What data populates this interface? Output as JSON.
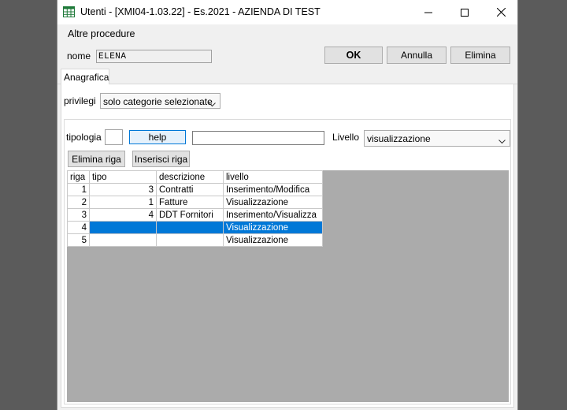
{
  "window": {
    "title": "Utenti - [XMI04-1.03.22] - Es.2021 - AZIENDA DI TEST",
    "menu_label": "Altre procedure",
    "accent_color": "#0078d7"
  },
  "header": {
    "name_label": "nome",
    "name_value": "ELENA",
    "ok_label": "OK",
    "annulla_label": "Annulla",
    "elimina_label": "Elimina"
  },
  "tabs": [
    {
      "label": "Anagrafica",
      "active": true
    }
  ],
  "privileges": {
    "label": "privilegi",
    "selected": "solo categorie selezionate"
  },
  "filter": {
    "tipologia_label": "tipologia",
    "tipologia_value": "",
    "help_label": "help",
    "text_value": "",
    "livello_label": "Livello",
    "livello_selected": "visualizzazione"
  },
  "actions": {
    "delete_row_label": "Elimina riga",
    "insert_row_label": "Inserisci riga"
  },
  "grid": {
    "columns": [
      "riga",
      "tipo",
      "descrizione",
      "livello"
    ],
    "rows": [
      {
        "riga": "1",
        "tipo": "3",
        "descrizione": "Contratti",
        "livello": "Inserimento/Modifica"
      },
      {
        "riga": "2",
        "tipo": "1",
        "descrizione": "Fatture",
        "livello": "Visualizzazione"
      },
      {
        "riga": "3",
        "tipo": "4",
        "descrizione": "DDT Fornitori",
        "livello": "Inserimento/Visualizza"
      },
      {
        "riga": "4",
        "tipo": "",
        "descrizione": "",
        "livello": "Visualizzazione",
        "selected": true
      },
      {
        "riga": "5",
        "tipo": "",
        "descrizione": "",
        "livello": "Visualizzazione"
      }
    ]
  }
}
